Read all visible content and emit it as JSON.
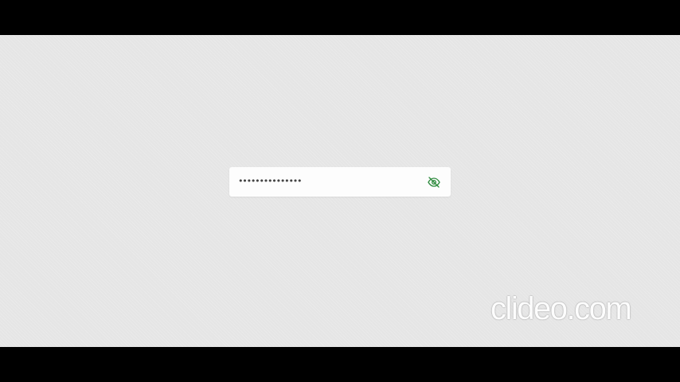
{
  "password_field": {
    "masked_value": "•••••••••••••••",
    "toggle_icon": "eye-slash-icon",
    "toggle_color": "#2e8b3e"
  },
  "watermark": {
    "text": "clideo.com"
  },
  "colors": {
    "background": "#e5e5e5",
    "letterbox": "#000000",
    "field_background": "#fdfdfd"
  }
}
